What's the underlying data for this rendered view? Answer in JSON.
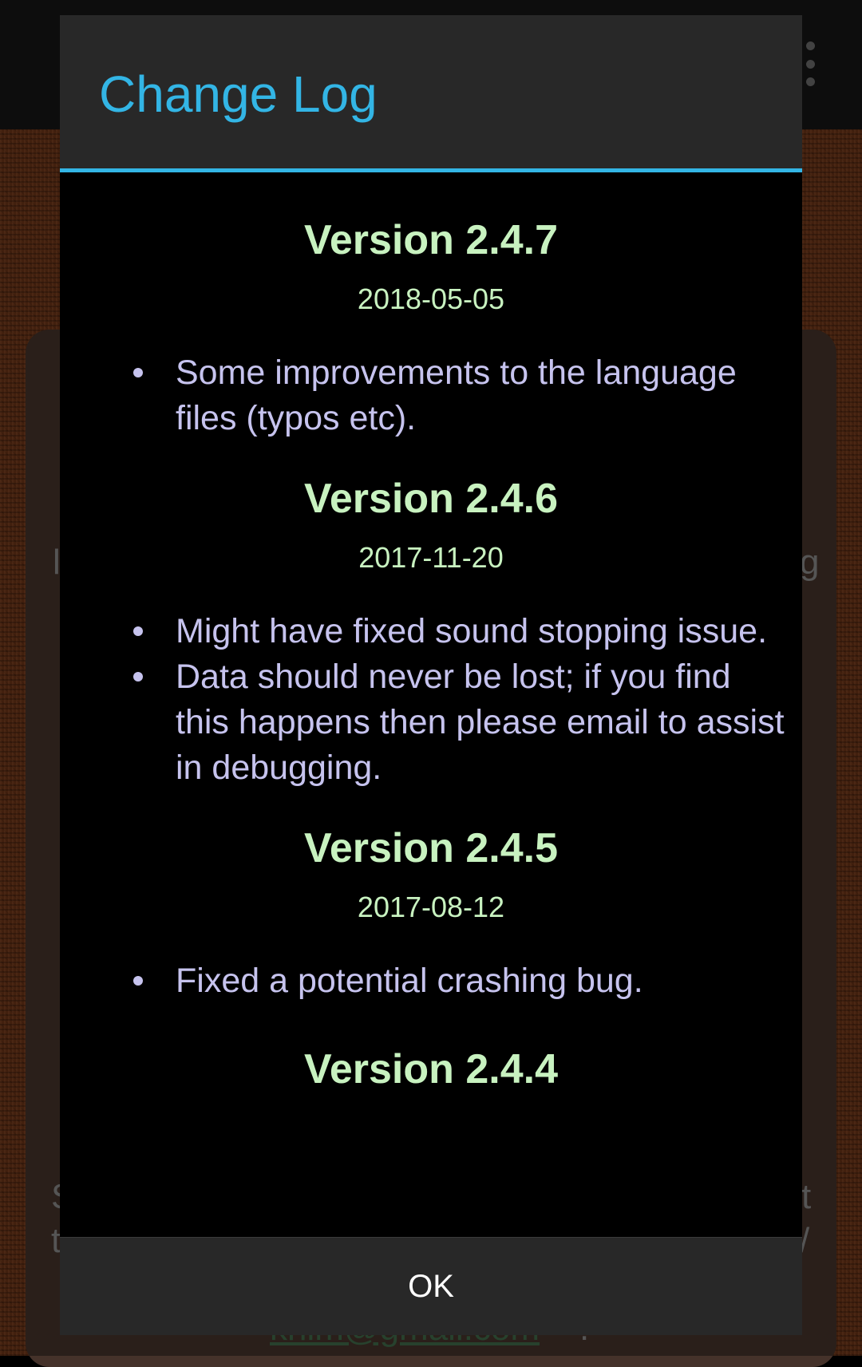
{
  "dialog": {
    "title": "Change Log",
    "ok_label": "OK",
    "accent_color": "#33b5e5",
    "versions": [
      {
        "title": "Version 2.4.7",
        "date": "2018-05-05",
        "changes": [
          "Some improvements to the language files (typos etc)."
        ]
      },
      {
        "title": "Version 2.4.6",
        "date": "2017-11-20",
        "changes": [
          "Might have fixed sound stopping issue.",
          "Data should never be lost; if you find this happens then please email to assist in debugging."
        ]
      },
      {
        "title": "Version 2.4.5",
        "date": "2017-08-12",
        "changes": [
          "Fixed a potential crashing bug."
        ]
      },
      {
        "title": "Version 2.4.4"
      }
    ]
  },
  "background": {
    "overflow_icon": "more-vert-icon",
    "email_text": "khim@gmail.com",
    "email_suffix": "."
  }
}
